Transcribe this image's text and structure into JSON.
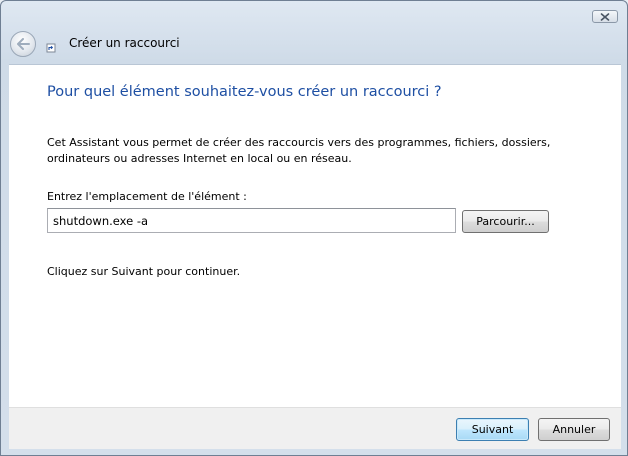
{
  "window": {
    "close_icon": "close-icon"
  },
  "header": {
    "back_icon": "back-arrow-icon",
    "app_icon": "shortcut-icon",
    "title": "Créer un raccourci"
  },
  "main": {
    "heading": "Pour quel élément souhaitez-vous créer un raccourci ?",
    "description": "Cet Assistant vous permet de créer des raccourcis vers des programmes, fichiers, dossiers, ordinateurs ou adresses Internet en local ou en réseau.",
    "location_label": "Entrez l'emplacement de l'élément :",
    "location_value": "shutdown.exe -a",
    "browse_label": "Parcourir...",
    "continue_text": "Cliquez sur Suivant pour continuer."
  },
  "footer": {
    "next_label": "Suivant",
    "cancel_label": "Annuler"
  },
  "colors": {
    "heading": "#1e4fa3",
    "accent_button_border": "#3c7fb1"
  }
}
